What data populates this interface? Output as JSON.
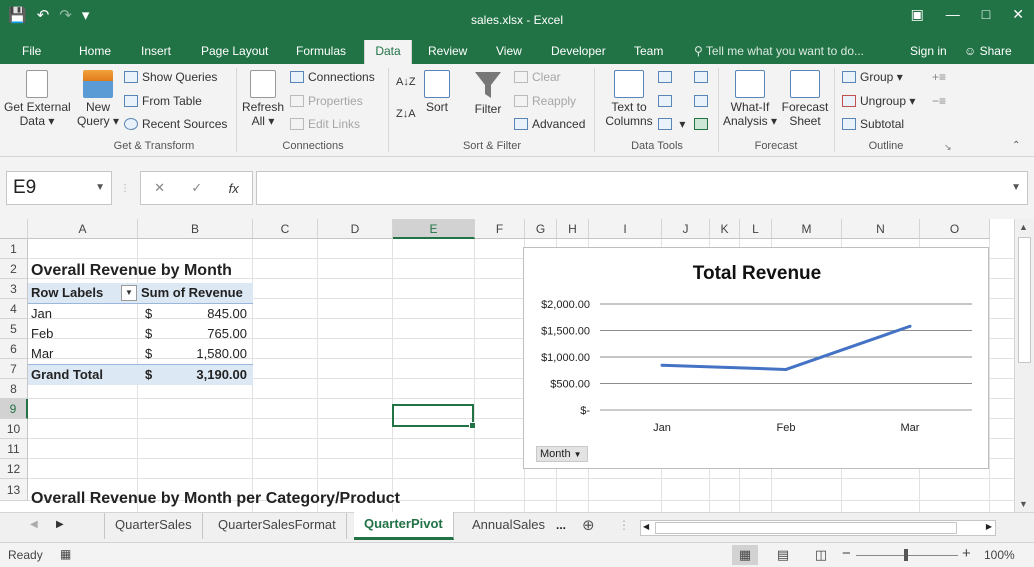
{
  "window": {
    "title": "sales.xlsx - Excel",
    "qat": [
      "save-icon",
      "undo-icon",
      "redo-icon",
      "customize-icon"
    ],
    "controls": [
      "ribbon-display-icon",
      "minimize-icon",
      "maximize-icon",
      "close-icon"
    ]
  },
  "tabs": {
    "items": [
      "File",
      "Home",
      "Insert",
      "Page Layout",
      "Formulas",
      "Data",
      "Review",
      "View",
      "Developer",
      "Team"
    ],
    "active": "Data",
    "tell_me": "Tell me what you want to do...",
    "sign_in": "Sign in",
    "share": "Share"
  },
  "ribbon": {
    "get_transform": {
      "label": "Get & Transform",
      "get_external_1": "Get External",
      "get_external_2": "Data",
      "new_query_1": "New",
      "new_query_2": "Query",
      "show_queries": "Show Queries",
      "from_table": "From Table",
      "recent_sources": "Recent Sources"
    },
    "connections": {
      "label": "Connections",
      "refresh_1": "Refresh",
      "refresh_2": "All",
      "connections": "Connections",
      "properties": "Properties",
      "edit_links": "Edit Links"
    },
    "sort_filter": {
      "label": "Sort & Filter",
      "sort": "Sort",
      "filter": "Filter",
      "clear": "Clear",
      "reapply": "Reapply",
      "advanced": "Advanced"
    },
    "data_tools": {
      "label": "Data Tools",
      "text_to_columns_1": "Text to",
      "text_to_columns_2": "Columns"
    },
    "forecast": {
      "label": "Forecast",
      "what_if_1": "What-If",
      "what_if_2": "Analysis",
      "forecast_sheet_1": "Forecast",
      "forecast_sheet_2": "Sheet"
    },
    "outline": {
      "label": "Outline",
      "group": "Group",
      "ungroup": "Ungroup",
      "subtotal": "Subtotal"
    }
  },
  "formula_bar": {
    "name_box": "E9",
    "fx": "fx",
    "formula": ""
  },
  "grid": {
    "columns": [
      "A",
      "B",
      "C",
      "D",
      "E",
      "F",
      "G",
      "H",
      "I",
      "J",
      "K",
      "L",
      "M",
      "N",
      "O"
    ],
    "rows": [
      "1",
      "2",
      "3",
      "4",
      "5",
      "6",
      "7",
      "8",
      "9",
      "10",
      "11",
      "12",
      "13"
    ],
    "selected_column": "E",
    "selected_row": "9"
  },
  "pivot": {
    "title": "Overall Revenue by Month",
    "row_labels": "Row Labels",
    "sum_header": "Sum of Revenue",
    "rows": [
      {
        "label": "Jan",
        "currency": "$",
        "value": "845.00"
      },
      {
        "label": "Feb",
        "currency": "$",
        "value": "765.00"
      },
      {
        "label": "Mar",
        "currency": "$",
        "value": "1,580.00"
      }
    ],
    "total": {
      "label": "Grand Total",
      "currency": "$",
      "value": "3,190.00"
    },
    "title2": "Overall Revenue by Month per Category/Product"
  },
  "chart_data": {
    "type": "line",
    "title": "Total Revenue",
    "categories": [
      "Jan",
      "Feb",
      "Mar"
    ],
    "series": [
      {
        "values": [
          845,
          765,
          1580
        ]
      }
    ],
    "y_ticks": [
      "$-",
      "$500.00",
      "$1,000.00",
      "$1,500.00",
      "$2,000.00"
    ],
    "ylim": [
      0,
      2000
    ],
    "grid": true,
    "line_color": "#4472c4",
    "field_button": "Month"
  },
  "sheets": {
    "items": [
      "QuarterSales",
      "QuarterSalesFormat",
      "QuarterPivot",
      "AnnualSales"
    ],
    "active": "QuarterPivot",
    "more": "..."
  },
  "status": {
    "ready": "Ready",
    "zoom": "100%"
  }
}
